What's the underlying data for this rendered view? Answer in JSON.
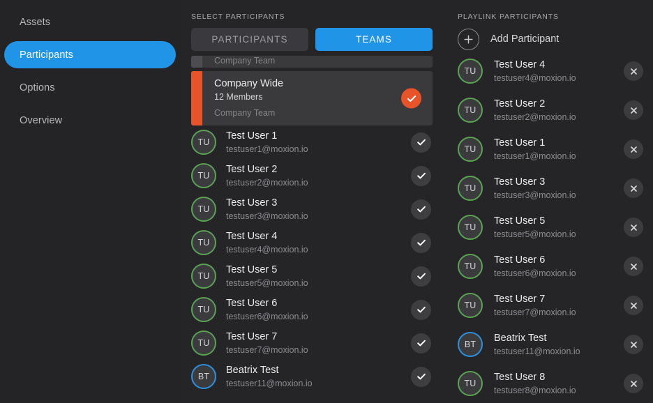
{
  "sidebar": {
    "items": [
      {
        "label": "Assets",
        "active": false
      },
      {
        "label": "Participants",
        "active": true
      },
      {
        "label": "Options",
        "active": false
      },
      {
        "label": "Overview",
        "active": false
      }
    ]
  },
  "middle": {
    "section_title": "SELECT PARTICIPANTS",
    "toggle": {
      "participants_label": "PARTICIPANTS",
      "teams_label": "TEAMS",
      "selected": "TEAMS"
    },
    "partial_team": {
      "footer": "Company Team"
    },
    "team": {
      "name": "Company Wide",
      "members": "12 Members",
      "footer": "Company Team",
      "selected": true,
      "accent": "#e8542a"
    },
    "people": [
      {
        "initials": "TU",
        "name": "Test User 1",
        "email": "testuser1@moxion.io",
        "ring": "green",
        "checked": true
      },
      {
        "initials": "TU",
        "name": "Test User 2",
        "email": "testuser2@moxion.io",
        "ring": "green",
        "checked": true
      },
      {
        "initials": "TU",
        "name": "Test User 3",
        "email": "testuser3@moxion.io",
        "ring": "green",
        "checked": true
      },
      {
        "initials": "TU",
        "name": "Test User 4",
        "email": "testuser4@moxion.io",
        "ring": "green",
        "checked": true
      },
      {
        "initials": "TU",
        "name": "Test User 5",
        "email": "testuser5@moxion.io",
        "ring": "green",
        "checked": true
      },
      {
        "initials": "TU",
        "name": "Test User 6",
        "email": "testuser6@moxion.io",
        "ring": "green",
        "checked": true
      },
      {
        "initials": "TU",
        "name": "Test User 7",
        "email": "testuser7@moxion.io",
        "ring": "green",
        "checked": true
      },
      {
        "initials": "BT",
        "name": "Beatrix Test",
        "email": "testuser11@moxion.io",
        "ring": "blue",
        "checked": true
      }
    ]
  },
  "right": {
    "section_title": "PLAYLINK PARTICIPANTS",
    "add_label": "Add Participant",
    "people": [
      {
        "initials": "TU",
        "name": "Test User 4",
        "email": "testuser4@moxion.io",
        "ring": "green"
      },
      {
        "initials": "TU",
        "name": "Test User 2",
        "email": "testuser2@moxion.io",
        "ring": "green"
      },
      {
        "initials": "TU",
        "name": "Test User 1",
        "email": "testuser1@moxion.io",
        "ring": "green"
      },
      {
        "initials": "TU",
        "name": "Test User 3",
        "email": "testuser3@moxion.io",
        "ring": "green"
      },
      {
        "initials": "TU",
        "name": "Test User 5",
        "email": "testuser5@moxion.io",
        "ring": "green"
      },
      {
        "initials": "TU",
        "name": "Test User 6",
        "email": "testuser6@moxion.io",
        "ring": "green"
      },
      {
        "initials": "TU",
        "name": "Test User 7",
        "email": "testuser7@moxion.io",
        "ring": "green"
      },
      {
        "initials": "BT",
        "name": "Beatrix Test",
        "email": "testuser11@moxion.io",
        "ring": "blue"
      },
      {
        "initials": "TU",
        "name": "Test User 8",
        "email": "testuser8@moxion.io",
        "ring": "green"
      }
    ]
  },
  "colors": {
    "accent_blue": "#2095e8",
    "accent_orange": "#e8542a",
    "ring_green": "#5aa352",
    "ring_blue": "#2b91e0",
    "background": "#252528"
  }
}
